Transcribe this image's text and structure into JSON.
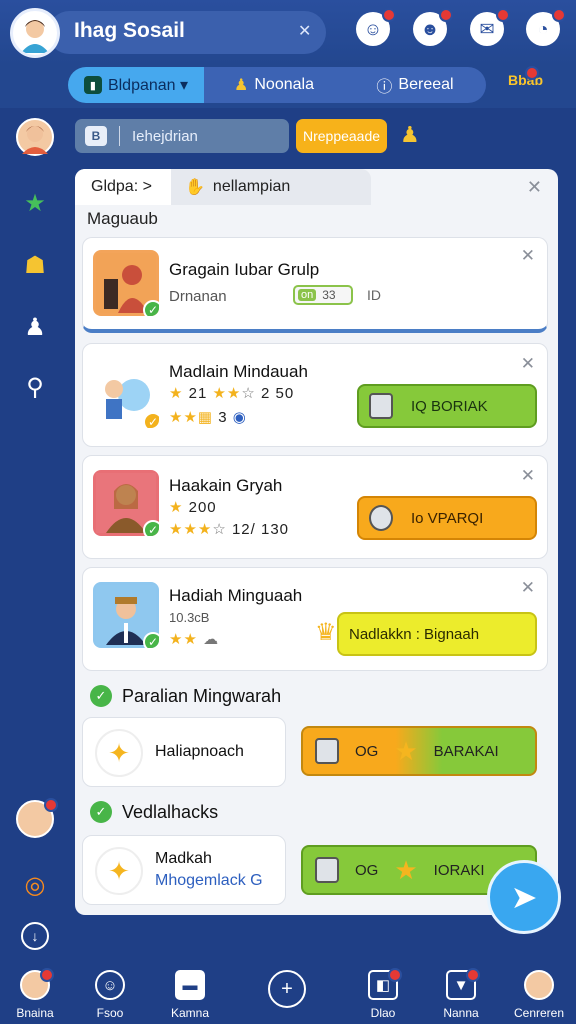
{
  "header": {
    "title": "Ihag Sosail",
    "close_glyph": "✕",
    "icons": [
      "chat-icon",
      "smile-icon",
      "message-icon",
      "alert-icon"
    ]
  },
  "tabs": [
    {
      "label": "Bldpanan ▾",
      "active": true
    },
    {
      "label": "Noonala",
      "active": false
    },
    {
      "label": "Bereeal",
      "active": false
    }
  ],
  "brand_badge": "Bbab",
  "search": {
    "placeholder": "Iehejdrian",
    "button": "Nreppeaade"
  },
  "panel": {
    "tab1": "Gldpa: >",
    "tab2": "nellampian",
    "section": "Maguaub"
  },
  "cards": [
    {
      "title": "Gragain Iubar Grulp",
      "subtitle": "Drnanan",
      "toggle_on": "on",
      "toggle_value": "33",
      "extra": "ID",
      "selected": true
    },
    {
      "title": "Madlain Mindauah",
      "rating_text": "21",
      "rating_extra": "2 50",
      "row2_value": "3",
      "button": "IQ  BORIAK",
      "button_color": "green"
    },
    {
      "title": "Haakain Gryah",
      "rating_text": "200",
      "rating_extra": "12/ 130",
      "button": "Io  VPARQI",
      "button_color": "orange"
    },
    {
      "title": "Hadiah Minguaah",
      "subtitle": "10.3cB",
      "button": "Nadlakkn : Bignaah",
      "button_color": "yellow"
    }
  ],
  "section2": {
    "title": "Paralian Mingwarah",
    "card_label": "Haliapnoach",
    "button_label": "OG",
    "button_text": "BARAKAI"
  },
  "section3": {
    "title": "Vedlalhacks",
    "card_label": "Madkah",
    "card_sub": "Mhogemlack G",
    "button_label": "OG",
    "button_text": "IORAKI"
  },
  "bottom_nav": [
    {
      "label": "Bnaina",
      "icon": "profile-icon"
    },
    {
      "label": "Fsoo",
      "icon": "smile-icon"
    },
    {
      "label": "Kamna",
      "icon": "window-icon"
    },
    {
      "label": "",
      "icon": "plus-icon"
    },
    {
      "label": "Dlao",
      "icon": "chat-icon"
    },
    {
      "label": "Nanna",
      "icon": "bookmark-icon"
    },
    {
      "label": "Cenreren",
      "icon": "user-icon"
    }
  ],
  "colors": {
    "background": "#1f3f86",
    "accent_blue": "#46a8ee",
    "green": "#86c93a",
    "orange": "#f8a91c",
    "yellow": "#ecec2c"
  }
}
